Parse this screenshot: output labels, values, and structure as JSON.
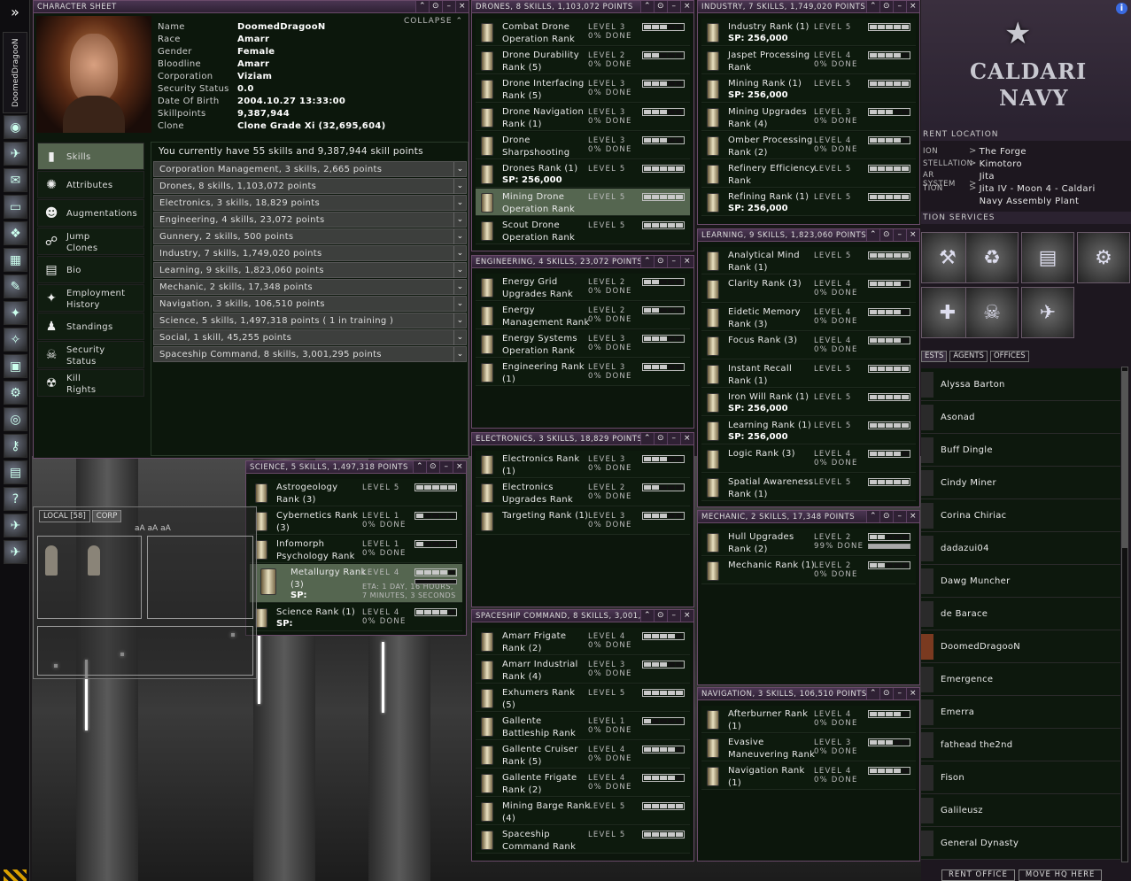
{
  "pilot_name_vertical": "DoomedDragooN",
  "character_sheet": {
    "title": "CHARACTER SHEET",
    "collapse": "COLLAPSE",
    "fields": [
      {
        "k": "Name",
        "v": "DoomedDragooN"
      },
      {
        "k": "Race",
        "v": "Amarr"
      },
      {
        "k": "Gender",
        "v": "Female"
      },
      {
        "k": "Bloodline",
        "v": "Amarr"
      },
      {
        "k": "Corporation",
        "v": "Viziam"
      },
      {
        "k": "Security Status",
        "v": "0.0"
      },
      {
        "k": "Date Of Birth",
        "v": "2004.10.27 13:33:00"
      },
      {
        "k": "Skillpoints",
        "v": "9,387,944"
      },
      {
        "k": "Clone",
        "v": "Clone Grade Xi (32,695,604)"
      }
    ],
    "nav": [
      {
        "label": "Skills",
        "icon": "book-icon"
      },
      {
        "label": "Attributes",
        "icon": "attributes-icon"
      },
      {
        "label": "Augmentations",
        "icon": "augmentations-icon"
      },
      {
        "label": "Jump\nClones",
        "icon": "jump-clones-icon"
      },
      {
        "label": "Bio",
        "icon": "bio-icon"
      },
      {
        "label": "Employment\nHistory",
        "icon": "employment-icon"
      },
      {
        "label": "Standings",
        "icon": "standings-icon"
      },
      {
        "label": "Security\nStatus",
        "icon": "security-icon"
      },
      {
        "label": "Kill\nRights",
        "icon": "kill-rights-icon"
      }
    ],
    "summary": "You currently have 55 skills and 9,387,944 skill points",
    "groups": [
      "Corporation Management, 3 skills, 2,665 points",
      "Drones, 8 skills, 1,103,072 points",
      "Electronics, 3 skills, 18,829 points",
      "Engineering, 4 skills, 23,072 points",
      "Gunnery, 2 skills, 500 points",
      "Industry, 7 skills, 1,749,020 points",
      "Learning, 9 skills, 1,823,060 points",
      "Mechanic, 2 skills, 17,348 points",
      "Navigation, 3 skills, 106,510 points",
      "Science, 5 skills, 1,497,318 points ( 1 in training )",
      "Social, 1 skill, 45,255 points",
      "Spaceship Command, 8 skills, 3,001,295 points"
    ]
  },
  "windows": {
    "drones": {
      "title": "DRONES, 8 SKILLS, 1,103,072 POINTS",
      "skills": [
        {
          "n": "Combat Drone Operation Rank",
          "lv": 3,
          "done": "0% DONE",
          "sp": ""
        },
        {
          "n": "Drone Durability Rank (5)",
          "lv": 2,
          "done": "0% DONE",
          "sp": ""
        },
        {
          "n": "Drone Interfacing Rank (5)",
          "lv": 3,
          "done": "0% DONE",
          "sp": ""
        },
        {
          "n": "Drone Navigation Rank (1)",
          "lv": 3,
          "done": "0% DONE",
          "sp": ""
        },
        {
          "n": "Drone Sharpshooting",
          "lv": 3,
          "done": "0% DONE",
          "sp": ""
        },
        {
          "n": "Drones Rank (1)",
          "lv": 5,
          "done": "",
          "sp": "SP: 256,000"
        },
        {
          "n": "Mining Drone Operation Rank",
          "lv": 5,
          "done": "",
          "sp": "",
          "sel": true
        },
        {
          "n": "Scout Drone Operation Rank",
          "lv": 5,
          "done": "",
          "sp": ""
        }
      ]
    },
    "engineering": {
      "title": "ENGINEERING, 4 SKILLS, 23,072 POINTS",
      "skills": [
        {
          "n": "Energy Grid Upgrades Rank",
          "lv": 2,
          "done": "0% DONE",
          "sp": ""
        },
        {
          "n": "Energy Management Rank",
          "lv": 2,
          "done": "0% DONE",
          "sp": ""
        },
        {
          "n": "Energy Systems Operation Rank",
          "lv": 3,
          "done": "0% DONE",
          "sp": ""
        },
        {
          "n": "Engineering Rank (1)",
          "lv": 3,
          "done": "0% DONE",
          "sp": ""
        }
      ]
    },
    "electronics": {
      "title": "ELECTRONICS, 3 SKILLS, 18,829 POINTS",
      "skills": [
        {
          "n": "Electronics Rank (1)",
          "lv": 3,
          "done": "0% DONE",
          "sp": ""
        },
        {
          "n": "Electronics Upgrades Rank",
          "lv": 2,
          "done": "0% DONE",
          "sp": ""
        },
        {
          "n": "Targeting Rank (1)",
          "lv": 3,
          "done": "0% DONE",
          "sp": ""
        }
      ]
    },
    "spaceship": {
      "title": "SPACESHIP COMMAND, 8 SKILLS, 3,001,295 POINTS",
      "skills": [
        {
          "n": "Amarr Frigate Rank (2)",
          "lv": 4,
          "done": "0% DONE",
          "sp": ""
        },
        {
          "n": "Amarr Industrial Rank (4)",
          "lv": 3,
          "done": "0% DONE",
          "sp": ""
        },
        {
          "n": "Exhumers Rank (5)",
          "lv": 5,
          "done": "",
          "sp": ""
        },
        {
          "n": "Gallente Battleship Rank (8)",
          "lv": 1,
          "done": "0% DONE",
          "sp": ""
        },
        {
          "n": "Gallente Cruiser Rank (5)",
          "lv": 4,
          "done": "0% DONE",
          "sp": ""
        },
        {
          "n": "Gallente Frigate Rank (2)",
          "lv": 4,
          "done": "0% DONE",
          "sp": ""
        },
        {
          "n": "Mining Barge Rank (4)",
          "lv": 5,
          "done": "",
          "sp": ""
        },
        {
          "n": "Spaceship Command Rank",
          "lv": 5,
          "done": "",
          "sp": ""
        }
      ]
    },
    "industry": {
      "title": "INDUSTRY, 7 SKILLS, 1,749,020 POINTS",
      "skills": [
        {
          "n": "Industry Rank (1)",
          "lv": 5,
          "done": "",
          "sp": "SP: 256,000"
        },
        {
          "n": "Jaspet Processing Rank",
          "lv": 4,
          "done": "0% DONE",
          "sp": ""
        },
        {
          "n": "Mining Rank (1)",
          "lv": 5,
          "done": "",
          "sp": "SP: 256,000"
        },
        {
          "n": "Mining Upgrades Rank (4)",
          "lv": 3,
          "done": "0% DONE",
          "sp": ""
        },
        {
          "n": "Omber Processing Rank (2)",
          "lv": 4,
          "done": "0% DONE",
          "sp": ""
        },
        {
          "n": "Refinery Efficiency Rank",
          "lv": 5,
          "done": "",
          "sp": ""
        },
        {
          "n": "Refining Rank (1)",
          "lv": 5,
          "done": "",
          "sp": "SP: 256,000"
        }
      ]
    },
    "learning": {
      "title": "LEARNING, 9 SKILLS, 1,823,060 POINTS",
      "skills": [
        {
          "n": "Analytical Mind Rank (1)",
          "lv": 5,
          "done": "",
          "sp": ""
        },
        {
          "n": "Clarity Rank (3)",
          "lv": 4,
          "done": "0% DONE",
          "sp": ""
        },
        {
          "n": "Eidetic Memory Rank (3)",
          "lv": 4,
          "done": "0% DONE",
          "sp": ""
        },
        {
          "n": "Focus Rank (3)",
          "lv": 4,
          "done": "0% DONE",
          "sp": ""
        },
        {
          "n": "Instant Recall Rank (1)",
          "lv": 5,
          "done": "",
          "sp": ""
        },
        {
          "n": "Iron Will Rank (1)",
          "lv": 5,
          "done": "",
          "sp": "SP: 256,000"
        },
        {
          "n": "Learning Rank (1)",
          "lv": 5,
          "done": "",
          "sp": "SP: 256,000"
        },
        {
          "n": "Logic Rank (3)",
          "lv": 4,
          "done": "0% DONE",
          "sp": ""
        },
        {
          "n": "Spatial Awareness Rank (1)",
          "lv": 5,
          "done": "",
          "sp": ""
        }
      ]
    },
    "mechanic": {
      "title": "MECHANIC, 2 SKILLS, 17,348 POINTS",
      "skills": [
        {
          "n": "Hull Upgrades Rank (2)",
          "lv": 2,
          "done": "99% DONE",
          "sp": "",
          "prog": 0.99
        },
        {
          "n": "Mechanic Rank (1)",
          "lv": 2,
          "done": "0% DONE",
          "sp": ""
        }
      ]
    },
    "navigation": {
      "title": "NAVIGATION, 3 SKILLS, 106,510 POINTS",
      "skills": [
        {
          "n": "Afterburner Rank (1)",
          "lv": 4,
          "done": "0% DONE",
          "sp": ""
        },
        {
          "n": "Evasive Maneuvering Rank",
          "lv": 3,
          "done": "0% DONE",
          "sp": ""
        },
        {
          "n": "Navigation Rank (1)",
          "lv": 4,
          "done": "0% DONE",
          "sp": ""
        }
      ]
    },
    "science": {
      "title": "SCIENCE, 5 SKILLS, 1,497,318 POINTS",
      "skills": [
        {
          "n": "Astrogeology Rank (3)",
          "lv": 5,
          "done": "",
          "sp": ""
        },
        {
          "n": "Cybernetics Rank (3)",
          "lv": 1,
          "done": "0% DONE",
          "sp": ""
        },
        {
          "n": "Infomorph Psychology Rank",
          "lv": 1,
          "done": "0% DONE",
          "sp": ""
        },
        {
          "n": "Metallurgy Rank (3)",
          "lv": 4,
          "done": "ETA: 1 DAY, 16 HOURS, 7 MINUTES, 3 SECONDS",
          "sp": "SP:",
          "sel": true
        },
        {
          "n": "Science Rank (1)",
          "lv": 4,
          "done": "0% DONE",
          "sp": "SP:"
        }
      ]
    }
  },
  "local_chat": {
    "tabs": [
      "LOCAL [58]",
      "CORP"
    ],
    "font_ctrls": "aA aA aA"
  },
  "station": {
    "logo_line1": "CALDARI",
    "logo_line2": "NAVY",
    "location_header": "RENT LOCATION",
    "location": [
      {
        "k": "ION",
        "v": "The Forge"
      },
      {
        "k": "STELLATION",
        "v": "Kimotoro"
      },
      {
        "k": "AR SYSTEM",
        "v": "Jita"
      },
      {
        "k": "TION",
        "v": "Jita IV - Moon 4 - Caldari\nNavy Assembly Plant"
      }
    ],
    "services_header": "TION SERVICES",
    "tabs": [
      "ESTS",
      "AGENTS",
      "OFFICES"
    ],
    "pilots": [
      "Alyssa Barton",
      "Asonad",
      "Buff Dingle",
      "Cindy Miner",
      "Corina Chiriac",
      "dadazui04",
      "Dawg Muncher",
      "de Barace",
      "DoomedDragooN",
      "Emergence",
      "Emerra",
      "fathead the2nd",
      "Fison",
      "Galileusz",
      "General Dynasty"
    ],
    "rent_office": "RENT OFFICE",
    "move_hq": "MOVE HQ HERE"
  }
}
